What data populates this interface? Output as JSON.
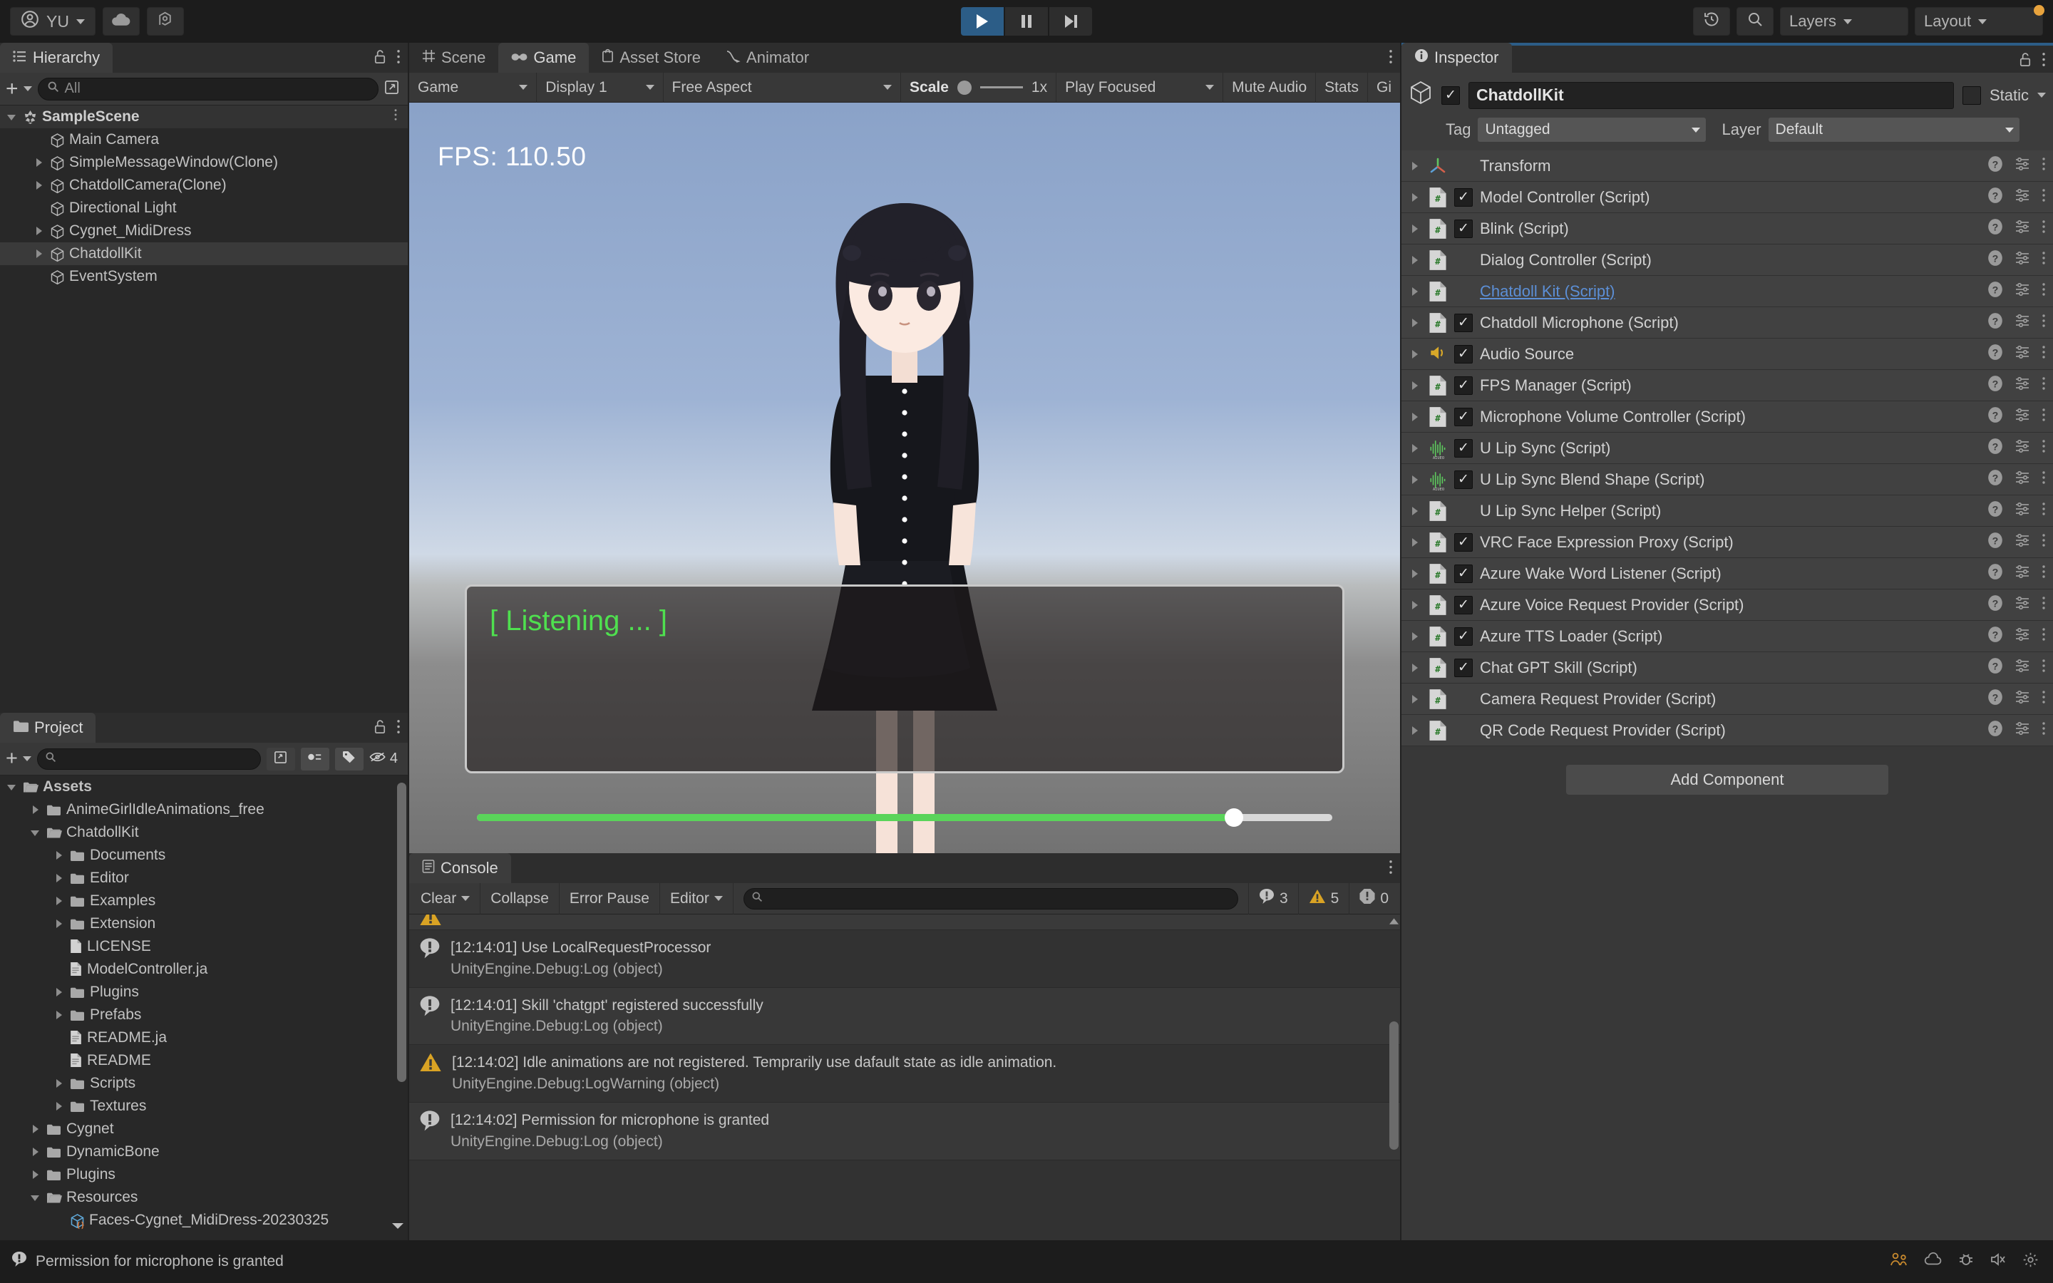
{
  "toolbar": {
    "account_label": "YU",
    "account_icon": "user-circle-icon",
    "cloud_icon": "cloud-icon",
    "services_icon": "unity-services-icon",
    "play_icon": "play-icon",
    "pause_icon": "pause-icon",
    "step_icon": "step-forward-icon",
    "history_icon": "undo-history-icon",
    "search_icon": "search-icon",
    "layers_label": "Layers",
    "layout_label": "Layout"
  },
  "hierarchy": {
    "tab_label": "Hierarchy",
    "tab_icon": "hierarchy-icon",
    "lock_icon": "lock-open-icon",
    "menu_icon": "kebab-menu-icon",
    "add_label": "+",
    "search_placeholder": "All",
    "items": [
      {
        "label": "SampleScene",
        "depth": 0,
        "arrow": "down",
        "icon": "unity-scene-icon",
        "selected": false,
        "scene": true
      },
      {
        "label": "Main Camera",
        "depth": 1,
        "arrow": "none",
        "icon": "gameobject-cube-icon",
        "selected": false,
        "scene": false
      },
      {
        "label": "SimpleMessageWindow(Clone)",
        "depth": 1,
        "arrow": "right",
        "icon": "gameobject-cube-icon",
        "selected": false,
        "scene": false
      },
      {
        "label": "ChatdollCamera(Clone)",
        "depth": 1,
        "arrow": "right",
        "icon": "gameobject-cube-icon",
        "selected": false,
        "scene": false
      },
      {
        "label": "Directional Light",
        "depth": 1,
        "arrow": "none",
        "icon": "gameobject-cube-icon",
        "selected": false,
        "scene": false
      },
      {
        "label": "Cygnet_MidiDress",
        "depth": 1,
        "arrow": "right",
        "icon": "gameobject-cube-icon",
        "selected": false,
        "scene": false
      },
      {
        "label": "ChatdollKit",
        "depth": 1,
        "arrow": "right",
        "icon": "gameobject-cube-icon",
        "selected": true,
        "scene": false
      },
      {
        "label": "EventSystem",
        "depth": 1,
        "arrow": "none",
        "icon": "gameobject-cube-icon",
        "selected": false,
        "scene": false
      }
    ]
  },
  "project": {
    "tab_label": "Project",
    "tab_icon": "project-folder-icon",
    "lock_icon": "lock-open-icon",
    "menu_icon": "kebab-menu-icon",
    "add_label": "+",
    "search_placeholder": "",
    "search_icon": "search-icon",
    "save_icon": "save-search-icon",
    "filter_type_icon": "filter-type-icon",
    "filter_label_icon": "filter-label-icon",
    "hidden_count_icon": "hidden-eye-icon",
    "hidden_count": "4",
    "items": [
      {
        "label": "Assets",
        "depth": 0,
        "arrow": "down",
        "icon": "folder-open-icon",
        "bold": true
      },
      {
        "label": "AnimeGirlIdleAnimations_free",
        "depth": 1,
        "arrow": "right",
        "icon": "folder-icon",
        "bold": false
      },
      {
        "label": "ChatdollKit",
        "depth": 1,
        "arrow": "down",
        "icon": "folder-open-icon",
        "bold": false
      },
      {
        "label": "Documents",
        "depth": 2,
        "arrow": "right",
        "icon": "folder-icon",
        "bold": false
      },
      {
        "label": "Editor",
        "depth": 2,
        "arrow": "right",
        "icon": "folder-icon",
        "bold": false
      },
      {
        "label": "Examples",
        "depth": 2,
        "arrow": "right",
        "icon": "folder-icon",
        "bold": false
      },
      {
        "label": "Extension",
        "depth": 2,
        "arrow": "right",
        "icon": "folder-icon",
        "bold": false
      },
      {
        "label": "LICENSE",
        "depth": 2,
        "arrow": "none",
        "icon": "file-plain-icon",
        "bold": false
      },
      {
        "label": "ModelController.ja",
        "depth": 2,
        "arrow": "none",
        "icon": "file-text-icon",
        "bold": false
      },
      {
        "label": "Plugins",
        "depth": 2,
        "arrow": "right",
        "icon": "folder-icon",
        "bold": false
      },
      {
        "label": "Prefabs",
        "depth": 2,
        "arrow": "right",
        "icon": "folder-icon",
        "bold": false
      },
      {
        "label": "README.ja",
        "depth": 2,
        "arrow": "none",
        "icon": "file-text-icon",
        "bold": false
      },
      {
        "label": "README",
        "depth": 2,
        "arrow": "none",
        "icon": "file-text-icon",
        "bold": false
      },
      {
        "label": "Scripts",
        "depth": 2,
        "arrow": "right",
        "icon": "folder-icon",
        "bold": false
      },
      {
        "label": "Textures",
        "depth": 2,
        "arrow": "right",
        "icon": "folder-icon",
        "bold": false
      },
      {
        "label": "Cygnet",
        "depth": 1,
        "arrow": "right",
        "icon": "folder-icon",
        "bold": false
      },
      {
        "label": "DynamicBone",
        "depth": 1,
        "arrow": "right",
        "icon": "folder-icon",
        "bold": false
      },
      {
        "label": "Plugins",
        "depth": 1,
        "arrow": "right",
        "icon": "folder-icon",
        "bold": false
      },
      {
        "label": "Resources",
        "depth": 1,
        "arrow": "down",
        "icon": "folder-open-icon",
        "bold": false
      },
      {
        "label": "Faces-Cygnet_MidiDress-20230325",
        "depth": 2,
        "arrow": "none",
        "icon": "prefab-cube-icon",
        "bold": false
      }
    ]
  },
  "gameview": {
    "tabs": [
      {
        "label": "Scene",
        "icon": "scene-grid-icon",
        "active": false
      },
      {
        "label": "Game",
        "icon": "game-controller-icon",
        "active": true
      },
      {
        "label": "Asset Store",
        "icon": "asset-store-icon",
        "active": false
      },
      {
        "label": "Animator",
        "icon": "animator-icon",
        "active": false
      }
    ],
    "menu_icon": "kebab-menu-icon",
    "toolbar": {
      "target_label": "Game",
      "display_label": "Display 1",
      "aspect_label": "Free Aspect",
      "scale_label": "Scale",
      "scale_value": "1x",
      "play_mode_label": "Play Focused",
      "mute_audio_label": "Mute Audio",
      "stats_label": "Stats",
      "gizmos_label": "Gi"
    },
    "fps_text": "FPS: 110.50",
    "message_text": "[ Listening ... ]",
    "volume_percent": 88.5,
    "accent_green": "#4fe04f"
  },
  "console": {
    "tab_label": "Console",
    "tab_icon": "console-icon",
    "menu_icon": "kebab-menu-icon",
    "clear_label": "Clear",
    "collapse_label": "Collapse",
    "error_pause_label": "Error Pause",
    "editor_label": "Editor",
    "search_placeholder": "",
    "search_icon": "search-icon",
    "info_count": "3",
    "warning_count": "5",
    "error_count": "0",
    "entries": [
      {
        "type": "info",
        "message": "[12:14:01] Use LocalRequestProcessor",
        "source": "UnityEngine.Debug:Log (object)"
      },
      {
        "type": "info",
        "message": "[12:14:01] Skill 'chatgpt' registered successfully",
        "source": "UnityEngine.Debug:Log (object)"
      },
      {
        "type": "warning",
        "message": "[12:14:02] Idle animations are not registered. Temprarily use dafault state as idle animation.",
        "source": "UnityEngine.Debug:LogWarning (object)"
      },
      {
        "type": "info",
        "message": "[12:14:02] Permission for microphone is granted",
        "source": "UnityEngine.Debug:Log (object)"
      }
    ]
  },
  "inspector": {
    "tab_label": "Inspector",
    "tab_icon": "info-circle-icon",
    "lock_icon": "lock-open-icon",
    "menu_icon": "kebab-menu-icon",
    "object_icon": "gameobject-cube-icon",
    "object_enabled": true,
    "object_name": "ChatdollKit",
    "static_label": "Static",
    "static_checked": false,
    "tag_label": "Tag",
    "tag_value": "Untagged",
    "layer_label": "Layer",
    "layer_value": "Default",
    "help_icon": "help-circle-icon",
    "preset_icon": "preset-sliders-icon",
    "kebab_icon": "kebab-menu-icon",
    "add_component_label": "Add Component",
    "components": [
      {
        "label": "Transform",
        "icon": "transform-axis-icon",
        "has_checkbox": false,
        "checked": false,
        "highlight": false
      },
      {
        "label": "Model Controller (Script)",
        "icon": "csharp-script-icon",
        "has_checkbox": true,
        "checked": true,
        "highlight": false
      },
      {
        "label": "Blink (Script)",
        "icon": "csharp-script-icon",
        "has_checkbox": true,
        "checked": true,
        "highlight": false
      },
      {
        "label": "Dialog Controller (Script)",
        "icon": "csharp-script-icon",
        "has_checkbox": false,
        "checked": false,
        "highlight": false
      },
      {
        "label": "Chatdoll Kit (Script)",
        "icon": "csharp-script-icon",
        "has_checkbox": false,
        "checked": false,
        "highlight": true
      },
      {
        "label": "Chatdoll Microphone (Script)",
        "icon": "csharp-script-icon",
        "has_checkbox": true,
        "checked": true,
        "highlight": false
      },
      {
        "label": "Audio Source",
        "icon": "audio-speaker-icon",
        "has_checkbox": true,
        "checked": true,
        "highlight": false
      },
      {
        "label": "FPS Manager (Script)",
        "icon": "csharp-script-icon",
        "has_checkbox": true,
        "checked": true,
        "highlight": false
      },
      {
        "label": "Microphone Volume Controller (Script)",
        "icon": "csharp-script-icon",
        "has_checkbox": true,
        "checked": true,
        "highlight": false
      },
      {
        "label": "U Lip Sync (Script)",
        "icon": "audio-waveform-icon",
        "has_checkbox": true,
        "checked": true,
        "highlight": false
      },
      {
        "label": "U Lip Sync Blend Shape (Script)",
        "icon": "audio-waveform-icon",
        "has_checkbox": true,
        "checked": true,
        "highlight": false
      },
      {
        "label": "U Lip Sync Helper (Script)",
        "icon": "csharp-script-icon",
        "has_checkbox": false,
        "checked": false,
        "highlight": false
      },
      {
        "label": "VRC Face Expression Proxy (Script)",
        "icon": "csharp-script-icon",
        "has_checkbox": true,
        "checked": true,
        "highlight": false
      },
      {
        "label": "Azure Wake Word Listener (Script)",
        "icon": "csharp-script-icon",
        "has_checkbox": true,
        "checked": true,
        "highlight": false
      },
      {
        "label": "Azure Voice Request Provider (Script)",
        "icon": "csharp-script-icon",
        "has_checkbox": true,
        "checked": true,
        "highlight": false
      },
      {
        "label": "Azure TTS Loader (Script)",
        "icon": "csharp-script-icon",
        "has_checkbox": true,
        "checked": true,
        "highlight": false
      },
      {
        "label": "Chat GPT Skill (Script)",
        "icon": "csharp-script-icon",
        "has_checkbox": true,
        "checked": true,
        "highlight": false
      },
      {
        "label": "Camera Request Provider (Script)",
        "icon": "csharp-script-icon",
        "has_checkbox": false,
        "checked": false,
        "highlight": false
      },
      {
        "label": "QR Code Request Provider (Script)",
        "icon": "csharp-script-icon",
        "has_checkbox": false,
        "checked": false,
        "highlight": false
      }
    ]
  },
  "statusbar": {
    "message": "Permission for microphone is granted",
    "message_icon": "info-bubble-icon",
    "right_icons": [
      "collab-icon",
      "cloud-build-icon",
      "bug-icon",
      "mute-icon",
      "settings-icon"
    ]
  }
}
